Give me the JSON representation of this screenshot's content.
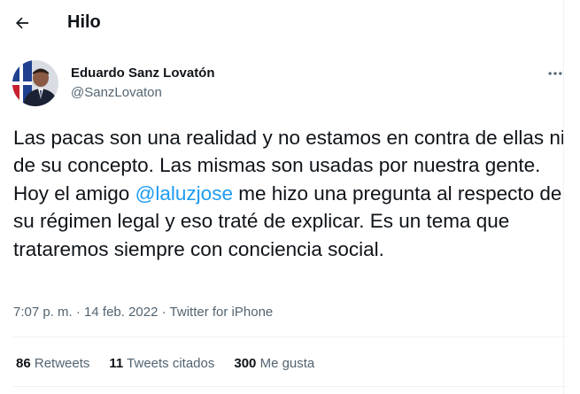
{
  "header": {
    "title": "Hilo",
    "back_icon": "back-arrow-icon"
  },
  "author": {
    "name": "Eduardo Sanz Lovatón",
    "handle": "@SanzLovaton"
  },
  "tweet": {
    "text_before": "Las pacas son una realidad y no estamos en contra de ellas ni de su concepto. Las mismas son usadas por nuestra gente. Hoy el amigo ",
    "mention": "@laluzjose",
    "text_after": " me hizo una pregunta al respecto de su régimen legal y eso traté de explicar. Es un tema que trataremos siempre con conciencia social."
  },
  "meta": {
    "time": "7:07 p. m.",
    "separator": "·",
    "date": "14 feb. 2022",
    "source": "Twitter for iPhone"
  },
  "stats": {
    "retweets_count": "86",
    "retweets_label": "Retweets",
    "quotes_count": "11",
    "quotes_label": "Tweets citados",
    "likes_count": "300",
    "likes_label": "Me gusta"
  },
  "colors": {
    "accent": "#1d9bf0",
    "text": "#0f1419",
    "secondary": "#536471",
    "divider": "#eff3f4"
  }
}
